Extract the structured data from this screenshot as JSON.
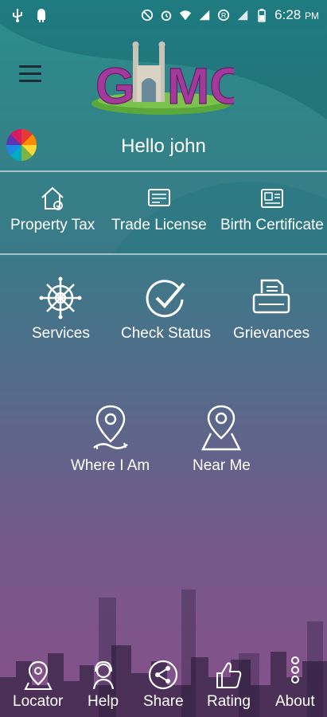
{
  "status_bar": {
    "time": "6:28",
    "ampm": "PM"
  },
  "header": {
    "logo_text": "GHMC",
    "greeting": "Hello john"
  },
  "top_menu": [
    {
      "label": "Property Tax",
      "icon": "house-icon"
    },
    {
      "label": "Trade License",
      "icon": "license-card-icon"
    },
    {
      "label": "Birth Certificate",
      "icon": "certificate-icon"
    }
  ],
  "main_menu": [
    {
      "label": "Services",
      "icon": "ship-wheel-icon"
    },
    {
      "label": "Check Status",
      "icon": "check-circle-icon"
    },
    {
      "label": "Grievances",
      "icon": "printer-icon"
    },
    {
      "label": "Where I Am",
      "icon": "location-pin-icon"
    },
    {
      "label": "Near Me",
      "icon": "map-pin-icon"
    }
  ],
  "bottom_nav": [
    {
      "label": "Locator",
      "icon": "locator-icon"
    },
    {
      "label": "Help",
      "icon": "help-agent-icon"
    },
    {
      "label": "Share",
      "icon": "share-icon"
    },
    {
      "label": "Rating",
      "icon": "thumbs-up-icon"
    },
    {
      "label": "About",
      "icon": "about-icon"
    }
  ],
  "colors": {
    "bg_top": "#2b8f90",
    "bg_bottom": "#86508a",
    "logo_purple": "#a23a9b",
    "logo_grass": "#5aa83a"
  }
}
